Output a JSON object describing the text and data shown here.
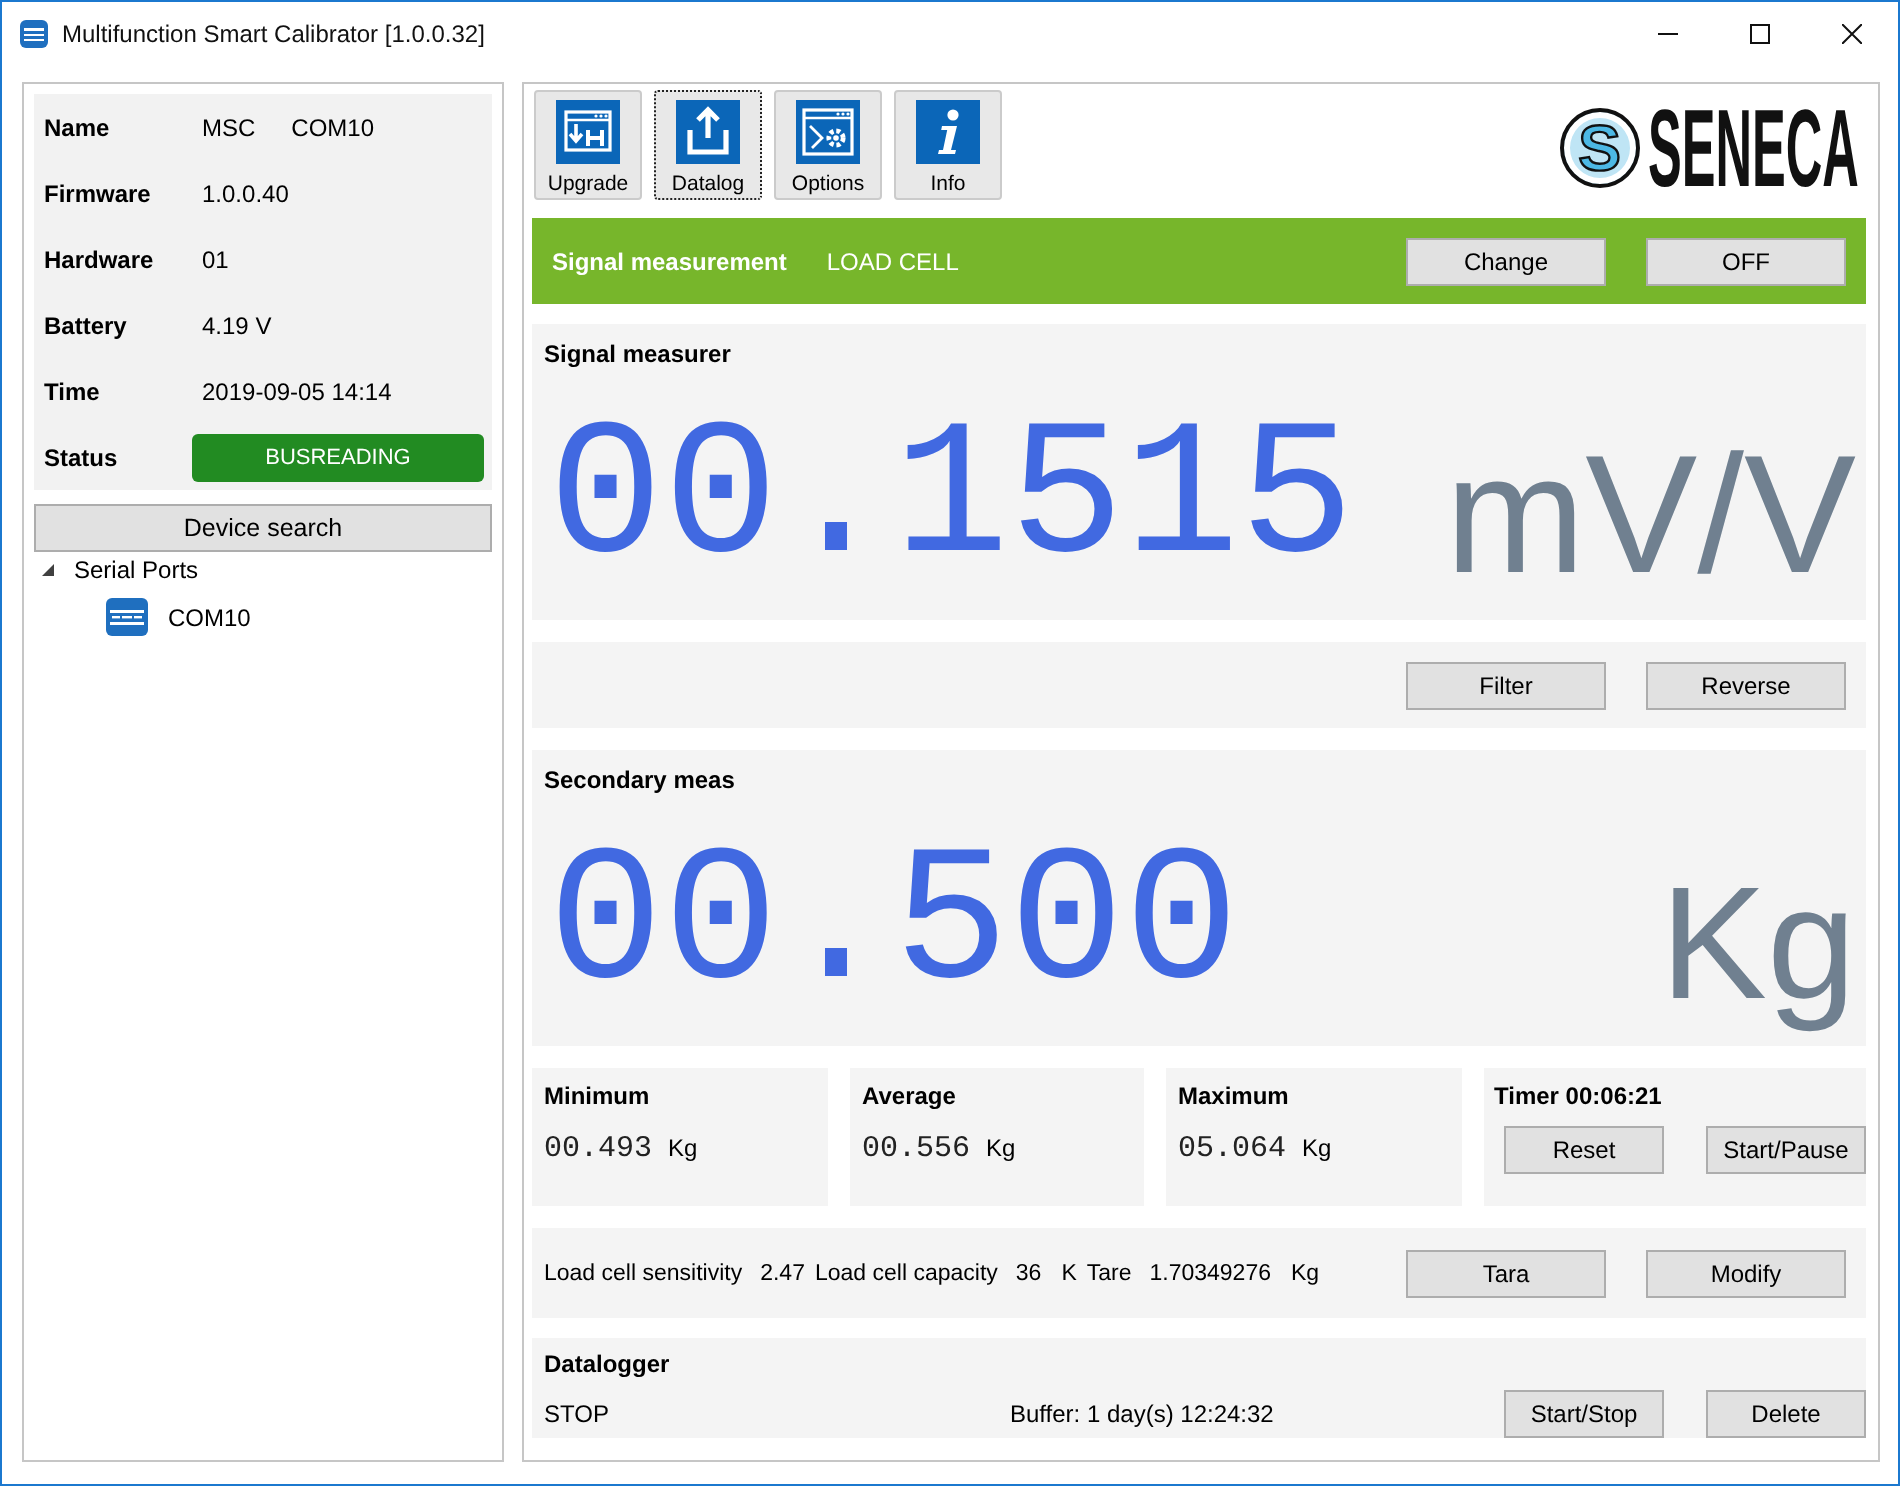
{
  "window": {
    "title": "Multifunction Smart Calibrator [1.0.0.32]"
  },
  "device_info": [
    {
      "label": "Name",
      "kind": "text",
      "values": [
        "MSC",
        "COM10"
      ]
    },
    {
      "label": "Firmware",
      "kind": "text",
      "values": [
        "1.0.0.40"
      ]
    },
    {
      "label": "Hardware",
      "kind": "text",
      "values": [
        "01"
      ]
    },
    {
      "label": "Battery",
      "kind": "text",
      "values": [
        "4.19 V"
      ]
    },
    {
      "label": "Time",
      "kind": "text",
      "values": [
        "2019-09-05 14:14"
      ]
    },
    {
      "label": "Status",
      "kind": "status",
      "values": [
        "BUSREADING"
      ]
    }
  ],
  "device_search_button": "Device search",
  "tree": [
    {
      "label": "Serial Ports",
      "expanded": true,
      "children": [
        {
          "label": "COM10"
        }
      ]
    }
  ],
  "toolbar": [
    {
      "label": "Upgrade",
      "focused": false
    },
    {
      "label": "Datalog",
      "focused": true
    },
    {
      "label": "Options",
      "focused": false
    },
    {
      "label": "Info",
      "focused": false
    }
  ],
  "logo": {
    "mark": "S",
    "text": "SENECA"
  },
  "signal_bar": {
    "title": "Signal measurement",
    "mode": "LOAD CELL",
    "buttons": [
      "Change",
      "OFF"
    ]
  },
  "signal_panel": {
    "title": "Signal measurer",
    "value": "00.1515",
    "unit": "mV/V"
  },
  "signal_controls": {
    "buttons": [
      "Filter",
      "Reverse"
    ]
  },
  "secondary_panel": {
    "title": "Secondary meas",
    "value": "00.500",
    "unit": "Kg"
  },
  "stats": [
    {
      "label": "Minimum",
      "value": "00.493",
      "unit": "Kg"
    },
    {
      "label": "Average",
      "value": "00.556",
      "unit": "Kg"
    },
    {
      "label": "Maximum",
      "value": "05.064",
      "unit": "Kg"
    }
  ],
  "timer": {
    "title": "Timer 00:06:21",
    "buttons": [
      "Reset",
      "Start/Pause"
    ]
  },
  "load_cell": {
    "fields": [
      {
        "label": "Load cell sensitivity",
        "value": "2.47"
      },
      {
        "label": "Load cell capacity",
        "value": "36",
        "unit": "K"
      },
      {
        "label": "Tare",
        "value": "1.70349276",
        "unit": "Kg"
      }
    ],
    "buttons": [
      "Tara",
      "Modify"
    ]
  },
  "datalogger": {
    "title": "Datalogger",
    "state": "STOP",
    "buffer": "Buffer: 1 day(s) 12:24:32",
    "buttons": [
      "Start/Stop",
      "Delete"
    ]
  }
}
